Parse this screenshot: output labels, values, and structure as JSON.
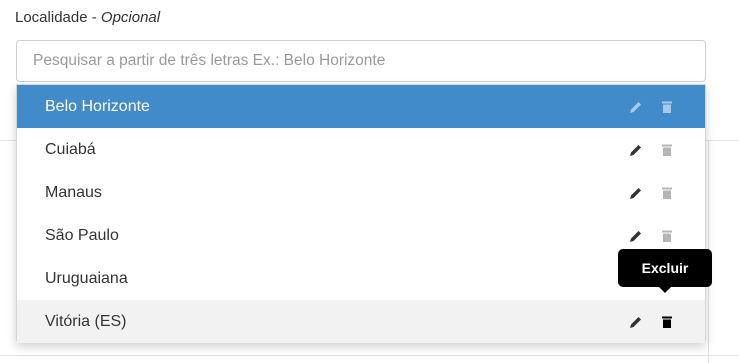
{
  "field": {
    "label": "Localidade - ",
    "label_optional": "Opcional",
    "placeholder": "Pesquisar a partir de três letras Ex.: Belo Horizonte"
  },
  "dropdown": {
    "items": [
      {
        "label": "Belo Horizonte",
        "state": "selected"
      },
      {
        "label": "Cuiabá",
        "state": "normal"
      },
      {
        "label": "Manaus",
        "state": "normal"
      },
      {
        "label": "São Paulo",
        "state": "normal"
      },
      {
        "label": "Uruguaiana",
        "state": "normal"
      },
      {
        "label": "Vitória (ES)",
        "state": "hover"
      }
    ],
    "icons": {
      "edit": "pencil-icon",
      "delete": "trash-icon"
    }
  },
  "tooltip": {
    "text": "Excluir"
  },
  "colors": {
    "selected_bg": "#428bca",
    "hover_bg": "#f2f2f2",
    "tooltip_bg": "#000000"
  }
}
